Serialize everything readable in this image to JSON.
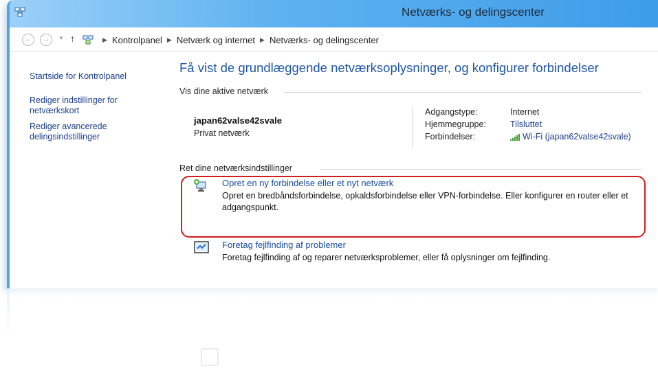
{
  "window": {
    "title": "Netværks- og delingscenter"
  },
  "address": {
    "crumbs": [
      "Kontrolpanel",
      "Netværk og internet",
      "Netværks- og delingscenter"
    ]
  },
  "sidebar": {
    "items": [
      {
        "label": "Startside for Kontrolpanel"
      },
      {
        "label": "Rediger indstillinger for netværkskort"
      },
      {
        "label": "Rediger avancerede delingsindstillinger"
      }
    ]
  },
  "main": {
    "heading": "Få vist de grundlæggende netværksoplysninger, og konfigurer forbindelser",
    "active_label": "Vis dine aktive netværk",
    "network": {
      "name": "japan62valse42svale",
      "type": "Privat netværk",
      "props": {
        "access_key": "Adgangstype:",
        "access_val": "Internet",
        "homegroup_key": "Hjemmegruppe:",
        "homegroup_val": "Tilsluttet",
        "connections_key": "Forbindelser:",
        "connections_val": "Wi-Fi (japan62valse42svale)"
      }
    },
    "settings_label": "Ret dine netværksindstillinger",
    "tasks": [
      {
        "title": "Opret en ny forbindelse eller et nyt netværk",
        "desc": "Opret en bredbåndsforbindelse, opkaldsforbindelse eller VPN-forbindelse. Eller konfigurer en router eller et adgangspunkt."
      },
      {
        "title": "Foretag fejlfinding af problemer",
        "desc": "Foretag fejlfinding af og reparer netværksproblemer, eller få oplysninger om fejlfinding."
      }
    ]
  },
  "colors": {
    "accent": "#3e9ce8",
    "link": "#1a4ea0",
    "highlight": "#d71a1a"
  }
}
